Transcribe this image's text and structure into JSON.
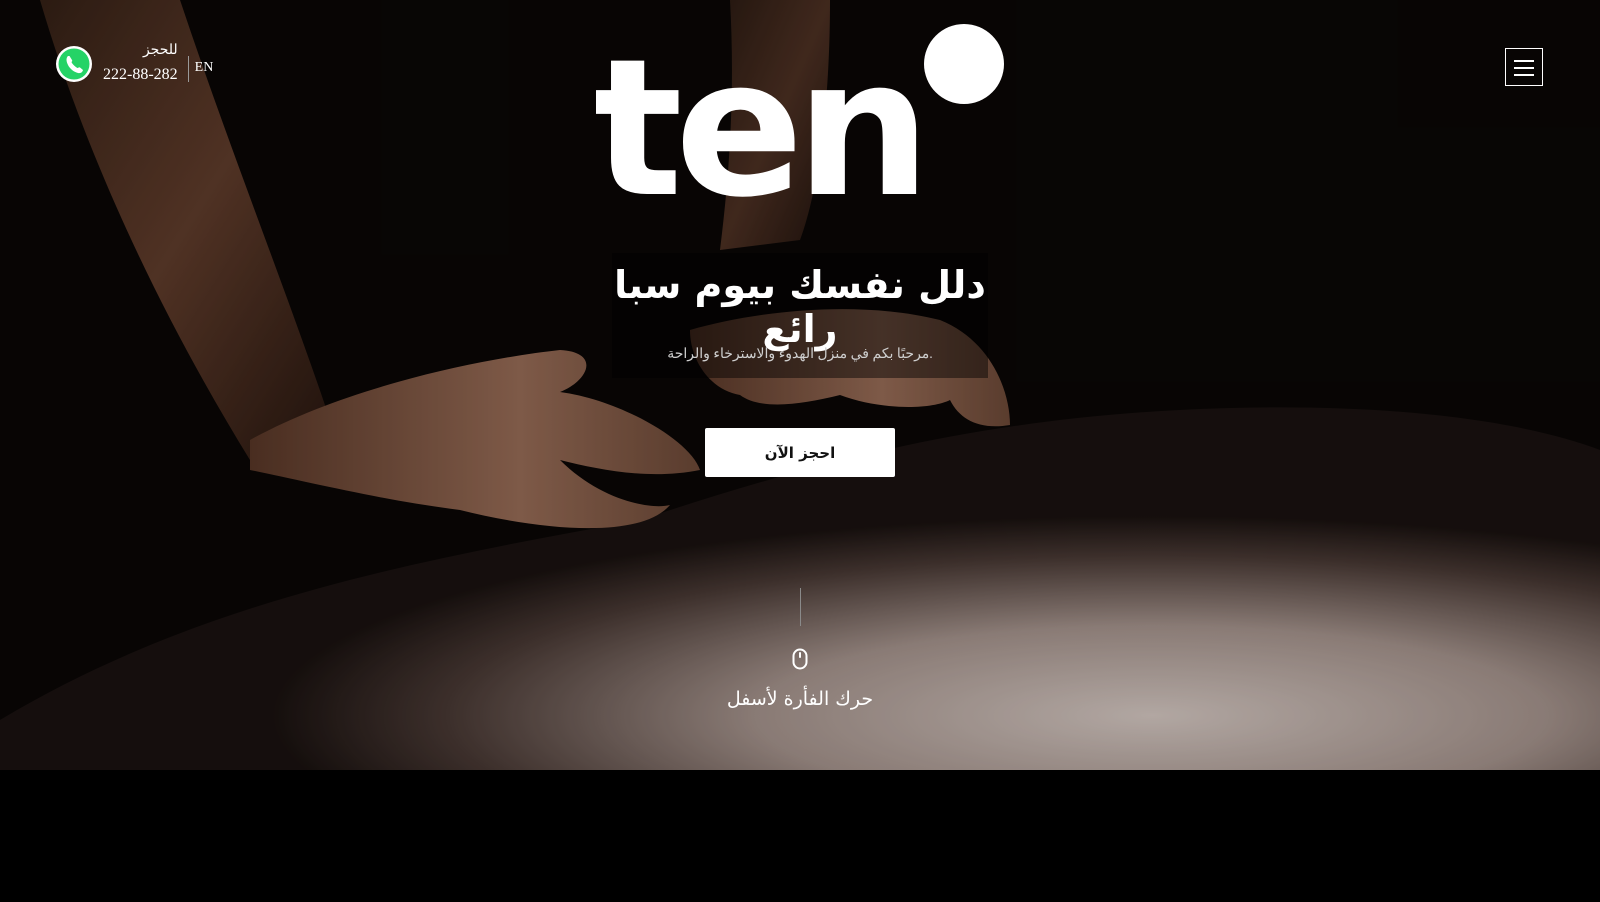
{
  "header": {
    "booking_label": "للحجز",
    "booking_phone": "222-88-282",
    "language_link": "EN"
  },
  "logo": {
    "text": "ten"
  },
  "hero": {
    "headline": "دلل نفسك بيوم سبا رائع",
    "subline": ".مرحبًا بكم في منزل الهدوء والاسترخاء والراحة",
    "cta_label": "احجز الآن",
    "scroll_hint": "حرك الفأرة لأسفل"
  },
  "icons": [
    "whatsapp-icon",
    "menu-icon",
    "mouse-icon"
  ],
  "colors": {
    "background": "#000000",
    "text": "#ffffff",
    "whatsapp": "#25D366",
    "cta_bg": "#ffffff"
  }
}
